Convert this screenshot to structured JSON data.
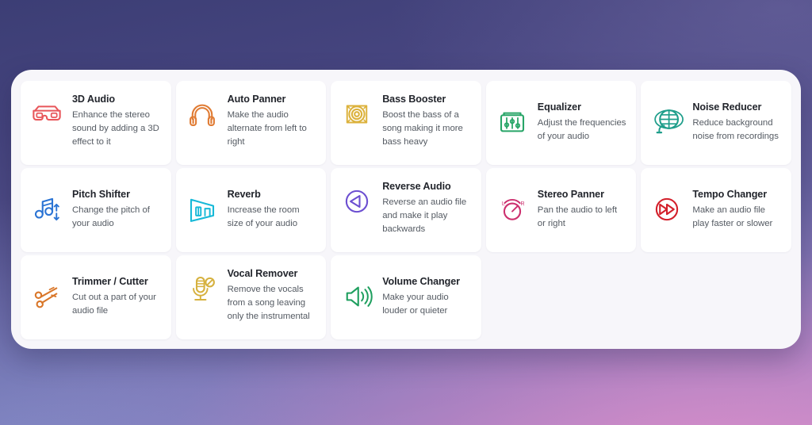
{
  "theme": {
    "background_gradient_top": "#3c3e75",
    "background_gradient_bottom_left": "#8088c4",
    "background_gradient_bottom_right": "#bb94cd",
    "panel_background": "#f7f6fa",
    "card_background": "#ffffff",
    "title_color": "#22252c",
    "description_color": "#555b63"
  },
  "panel": {
    "cards": [
      {
        "title": "3D Audio",
        "description": "Enhance the stereo sound by adding a 3D effect to it",
        "icon": "3d-glasses-icon",
        "color": "#e8565a"
      },
      {
        "title": "Auto Panner",
        "description": "Make the audio alternate from left to right",
        "icon": "headphones-icon",
        "color": "#e07b33"
      },
      {
        "title": "Bass Booster",
        "description": "Boost the bass of a song making it more bass heavy",
        "icon": "speaker-waves-icon",
        "color": "#dcb23c"
      },
      {
        "title": "Equalizer",
        "description": "Adjust the frequencies of your audio",
        "icon": "equalizer-sliders-icon",
        "color": "#27a567"
      },
      {
        "title": "Noise Reducer",
        "description": "Reduce background noise from recordings",
        "icon": "globe-noise-icon",
        "color": "#1f9e8b"
      },
      {
        "title": "Pitch Shifter",
        "description": "Change the pitch of your audio",
        "icon": "music-note-arrows-icon",
        "color": "#2b74d4"
      },
      {
        "title": "Reverb",
        "description": "Increase the room size of your audio",
        "icon": "room-perspective-icon",
        "color": "#17b9d8"
      },
      {
        "title": "Reverse Audio",
        "description": "Reverse an audio file and make it play backwards",
        "icon": "reverse-play-icon",
        "color": "#6c4fd1"
      },
      {
        "title": "Stereo Panner",
        "description": "Pan the audio to left or right",
        "icon": "pan-knob-icon",
        "color": "#cc2f6e"
      },
      {
        "title": "Tempo Changer",
        "description": "Make an audio file play faster or slower",
        "icon": "fast-forward-icon",
        "color": "#d3202b"
      },
      {
        "title": "Trimmer / Cutter",
        "description": "Cut out a part of your audio file",
        "icon": "scissors-icon",
        "color": "#d9772a"
      },
      {
        "title": "Vocal Remover",
        "description": "Remove the vocals from a song leaving only the instrumental",
        "icon": "microphone-blocked-icon",
        "color": "#d6b13f"
      },
      {
        "title": "Volume Changer",
        "description": "Make your audio louder or quieter",
        "icon": "volume-speaker-icon",
        "color": "#1f9f5f"
      }
    ],
    "knob_labels": {
      "left": "L",
      "right": "R"
    }
  }
}
